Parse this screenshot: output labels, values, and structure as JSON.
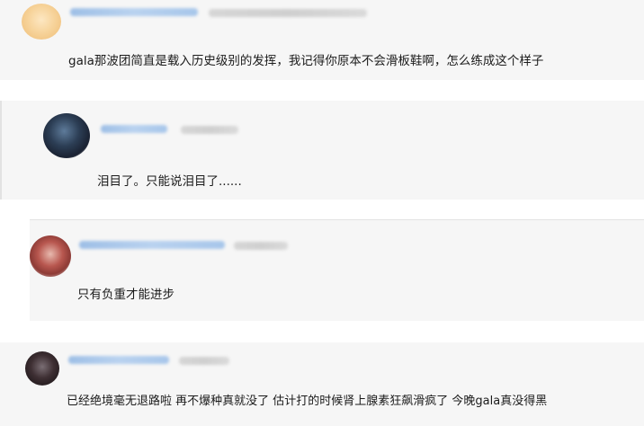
{
  "comments": [
    {
      "text": "gala那波团简直是载入历史级别的发挥，我记得你原本不会滑板鞋啊，怎么练成这个样子"
    },
    {
      "text": "泪目了。只能说泪目了......"
    },
    {
      "text": "只有负重才能进步"
    },
    {
      "text": "已经绝境毫无退路啦 再不爆种真就没了 估计打的时候肾上腺素狂飙滑疯了 今晚gala真没得黑"
    }
  ],
  "icons": {
    "avatar_1": "avatar-icon",
    "avatar_2": "avatar-icon",
    "avatar_3": "avatar-icon",
    "avatar_4": "avatar-icon"
  },
  "colors": {
    "card_bg": "#f6f6f6",
    "username_blur": "#a7c6ea",
    "meta_blur": "#d3d3d3",
    "reply_divider": "#e2e2e2"
  }
}
